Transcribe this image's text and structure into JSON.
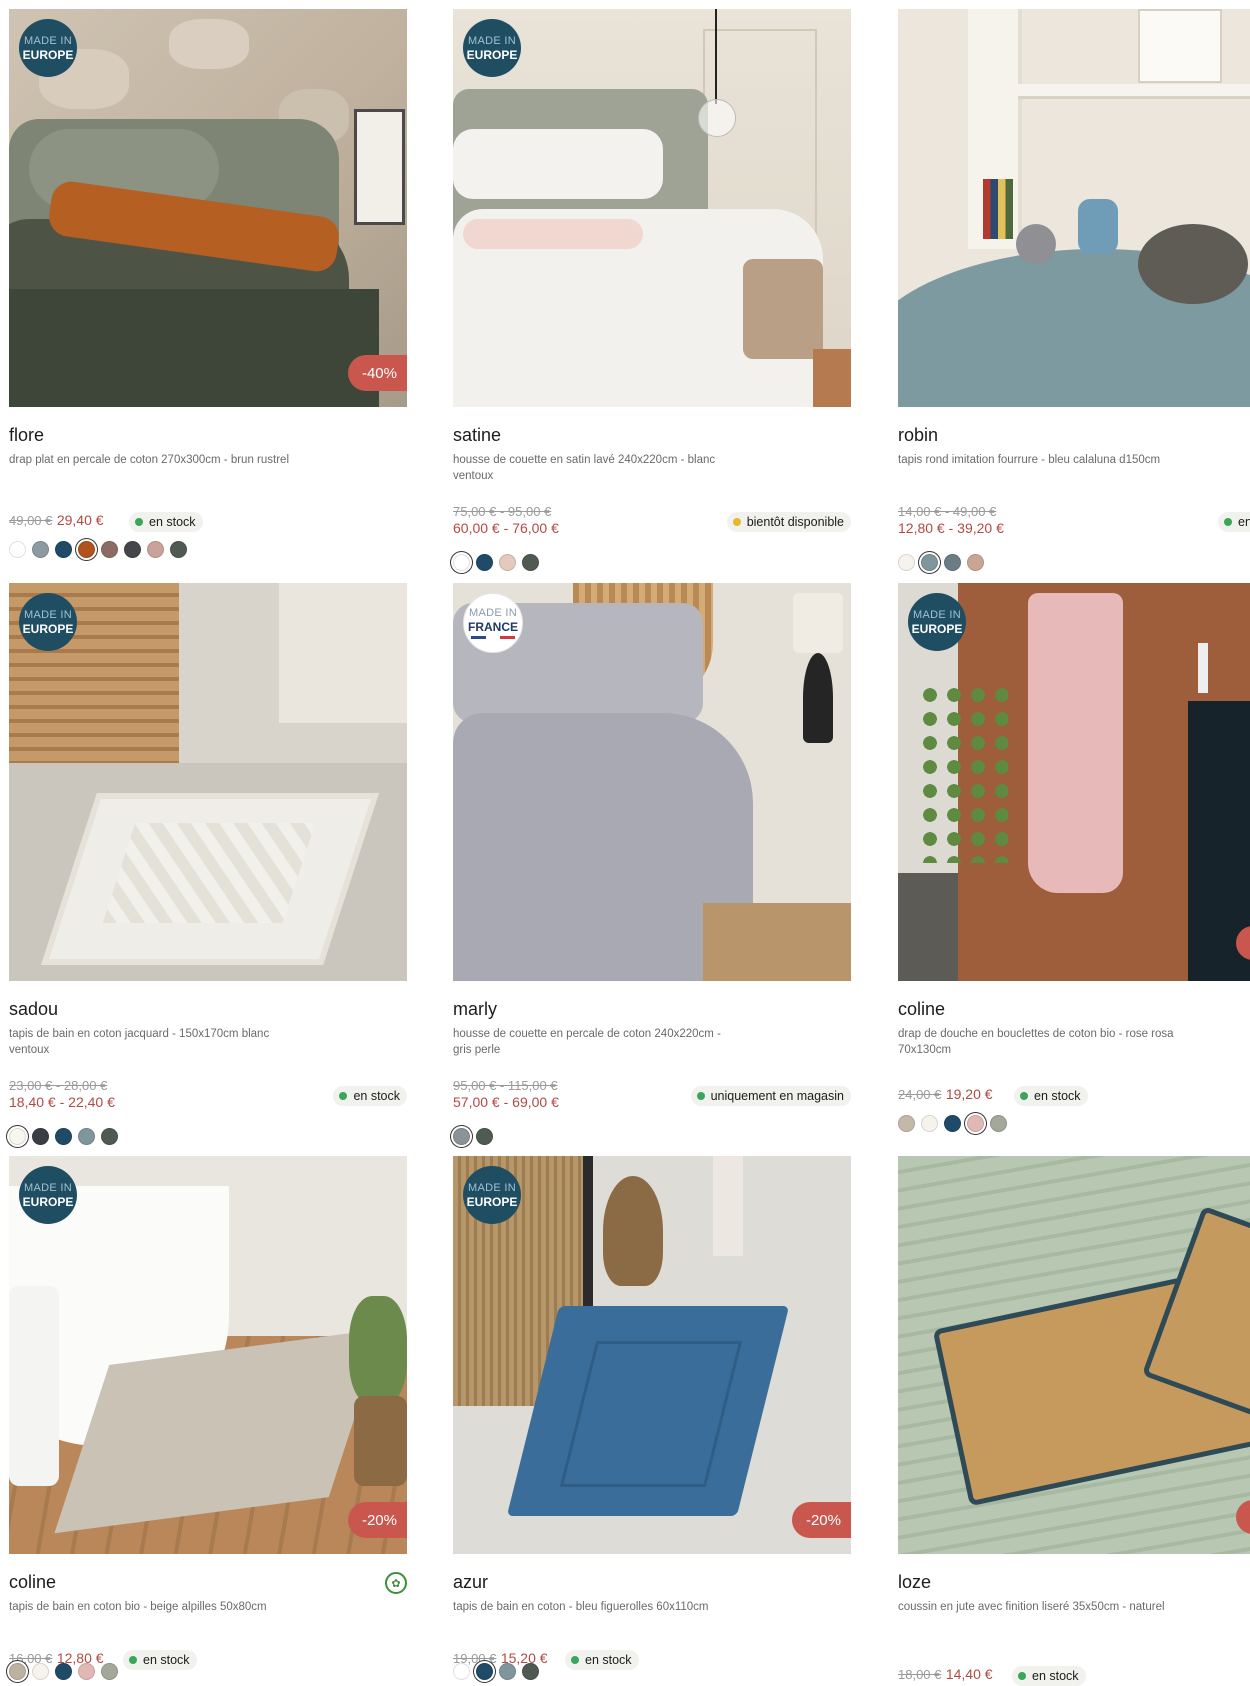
{
  "products": [
    {
      "name": "flore",
      "description": "drap plat en percale de coton 270x300cm - brun rustrel",
      "old_price": "49,00 €",
      "new_price": "29,40 €",
      "stock": "en stock",
      "stock_color": "#3aa65a",
      "discount": "-40%",
      "badge_l1": "MADE IN",
      "badge_l2": "EUROPE",
      "swatches": [
        "#ffffff",
        "#8e9aa1",
        "#1f4b68",
        "#b0531e",
        "#8c6b66",
        "#44464c",
        "#c9a299",
        "#4f5b52"
      ]
    },
    {
      "name": "satine",
      "description": "housse de couette en satin lavé 240x220cm - blanc ventoux",
      "old_price": "75,00 € - 95,00 €",
      "new_price": "60,00 € - 76,00 €",
      "stock": "bientôt disponible",
      "stock_color": "#e6b82d",
      "badge_l1": "MADE IN",
      "badge_l2": "EUROPE",
      "swatches": [
        "#ffffff",
        "#1f4b68",
        "#e4c9be",
        "#4f5b52"
      ]
    },
    {
      "name": "robin",
      "description": "tapis rond imitation fourrure - bleu calaluna d150cm",
      "old_price": "14,00 € - 49,00 €",
      "new_price": "12,80 € - 39,20 €",
      "stock": "en stock",
      "stock_color": "#3aa65a",
      "swatches": [
        "#f6f3ec",
        "#7f969c",
        "#6b7c84",
        "#c9a593"
      ]
    },
    {
      "name": "sadou",
      "description": "tapis de bain en coton jacquard - 150x170cm blanc ventoux",
      "old_price": "23,00 € - 28,00 €",
      "new_price": "18,40 € - 22,40 €",
      "stock": "en stock",
      "stock_color": "#3aa65a",
      "badge_l1": "MADE IN",
      "badge_l2": "EUROPE",
      "swatches": [
        "#f8f6ee",
        "#3b3d44",
        "#1f4b68",
        "#7f969c",
        "#4f5b52"
      ]
    },
    {
      "name": "marly",
      "description": "housse de couette en percale de coton 240x220cm - gris perle",
      "old_price": "95,00 € - 115,00 €",
      "new_price": "57,00 € - 69,00 €",
      "stock": "uniquement en magasin",
      "stock_color": "#3aa65a",
      "badge_l1": "MADE IN",
      "badge_l2": "FRANCE",
      "swatches": [
        "#8a9398",
        "#4f5b52"
      ]
    },
    {
      "name": "coline",
      "description": "drap de douche en bouclettes de coton bio - rose rosa 70x130cm",
      "old_price": "24,00 €",
      "new_price": "19,20 €",
      "stock": "en stock",
      "stock_color": "#3aa65a",
      "badge_l1": "MADE IN",
      "badge_l2": "EUROPE",
      "swatches": [
        "#c4b8a9",
        "#f6f3ec",
        "#1f4b68",
        "#e2b8b5",
        "#a4a89a"
      ]
    },
    {
      "name": "coline",
      "description": "tapis de bain en coton bio - beige alpilles 50x80cm",
      "old_price": "16,00 €",
      "new_price": "12,80 €",
      "stock": "en stock",
      "stock_color": "#3aa65a",
      "discount": "-20%",
      "badge_l1": "MADE IN",
      "badge_l2": "EUROPE",
      "swatches": [
        "#bdb2a0",
        "#f6f3ec",
        "#1f4b68",
        "#e2b8b5",
        "#a4a89a"
      ]
    },
    {
      "name": "azur",
      "description": "tapis de bain en coton - bleu figuerolles 60x110cm",
      "old_price": "19,00 €",
      "new_price": "15,20 €",
      "stock": "en stock",
      "stock_color": "#3aa65a",
      "discount": "-20%",
      "badge_l1": "MADE IN",
      "badge_l2": "EUROPE",
      "swatches": [
        "#ffffff",
        "#1f4b68",
        "#7f969c",
        "#4f5b52"
      ]
    },
    {
      "name": "loze",
      "description": "coussin en jute avec finition liseré 35x50cm - naturel",
      "old_price": "18,00 €",
      "new_price": "14,40 €",
      "stock": "en stock",
      "stock_color": "#3aa65a",
      "swatches": []
    }
  ]
}
